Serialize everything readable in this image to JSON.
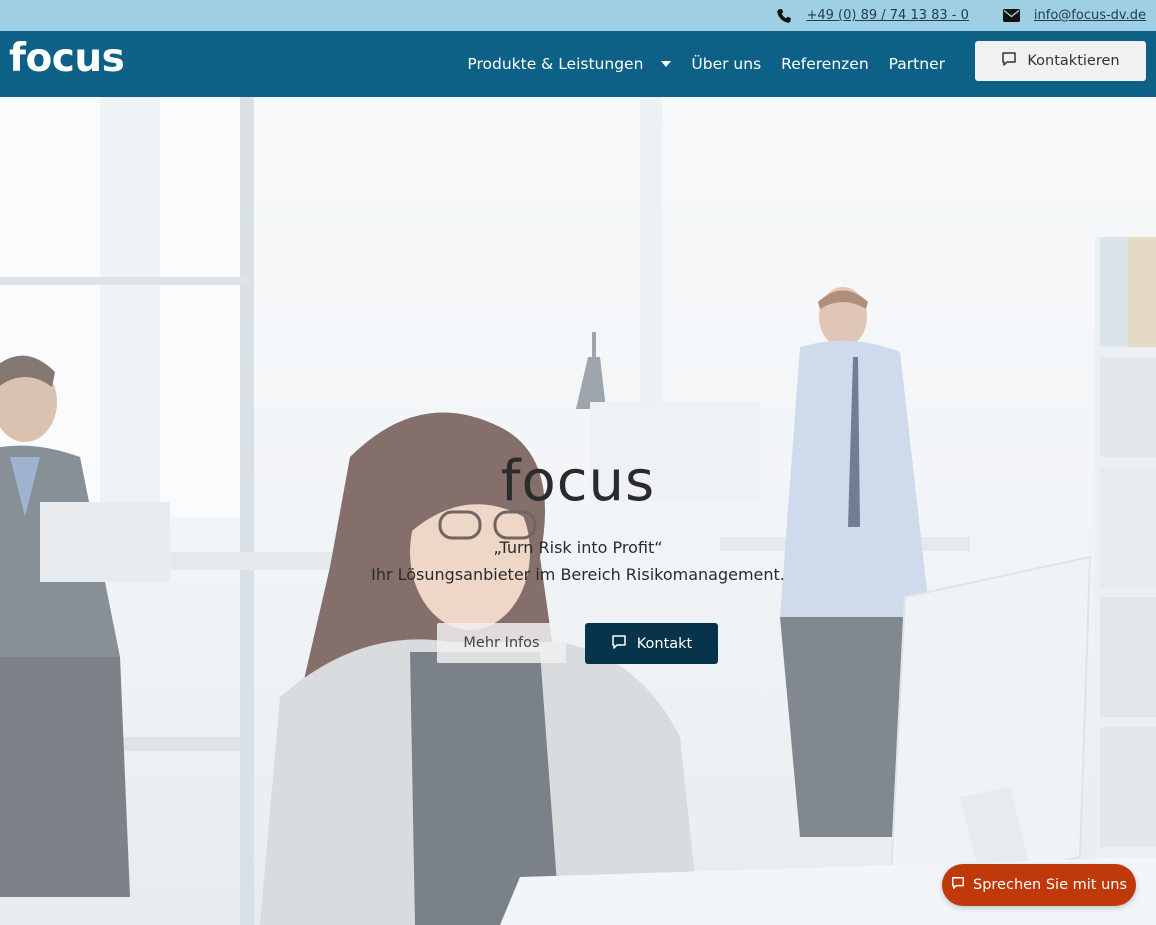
{
  "topbar": {
    "phone": "+49 (0) 89 / 74 13 83 - 0",
    "email": "info@focus-dv.de",
    "phone_icon": "phone-icon",
    "email_icon": "envelope-icon"
  },
  "header": {
    "logo": "focus",
    "nav": [
      {
        "label": "Produkte & Leistungen",
        "dropdown": true
      },
      {
        "label": "Über uns"
      },
      {
        "label": "Referenzen"
      },
      {
        "label": "Partner"
      }
    ],
    "cta_label": "Kontaktieren",
    "cta_icon": "speech-bubble-icon"
  },
  "hero": {
    "title": "focus",
    "tagline": "„Turn Risk into Profit“",
    "subtitle": "Ihr Lösungsanbieter im Bereich Risikomanagement.",
    "more_label": "Mehr Infos",
    "contact_label": "Kontakt"
  },
  "chat": {
    "label": "Sprechen Sie mit uns",
    "icon": "chat-icon"
  },
  "colors": {
    "topbar": "#9fcfe2",
    "navbar": "#0d6186",
    "contact_button": "#07344a",
    "chat_button": "#c0390b"
  }
}
